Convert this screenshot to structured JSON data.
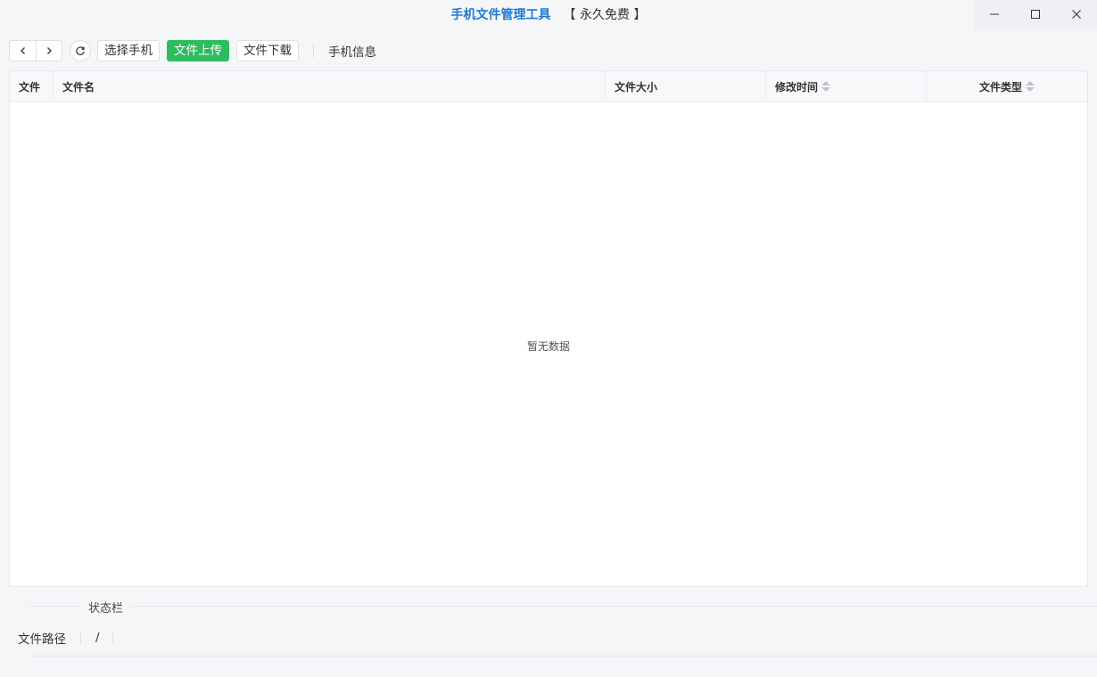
{
  "window": {
    "app_title": "手机文件管理工具",
    "free_badge": "【 永久免费 】"
  },
  "toolbar": {
    "select_phone": "选择手机",
    "upload": "文件上传",
    "download": "文件下载",
    "phone_info": "手机信息"
  },
  "table": {
    "columns": [
      "文件",
      "文件名",
      "文件大小",
      "修改时间",
      "文件类型"
    ],
    "empty_text": "暂无数据"
  },
  "status": {
    "title": "状态栏",
    "path_label": "文件路径",
    "path_value": "/"
  },
  "colors": {
    "accent_blue": "#1e78d2",
    "primary_green": "#2dbd5f"
  },
  "icons": [
    "minimize-icon",
    "maximize-icon",
    "close-icon",
    "chevron-left-icon",
    "chevron-right-icon",
    "refresh-icon",
    "sort-icon"
  ]
}
